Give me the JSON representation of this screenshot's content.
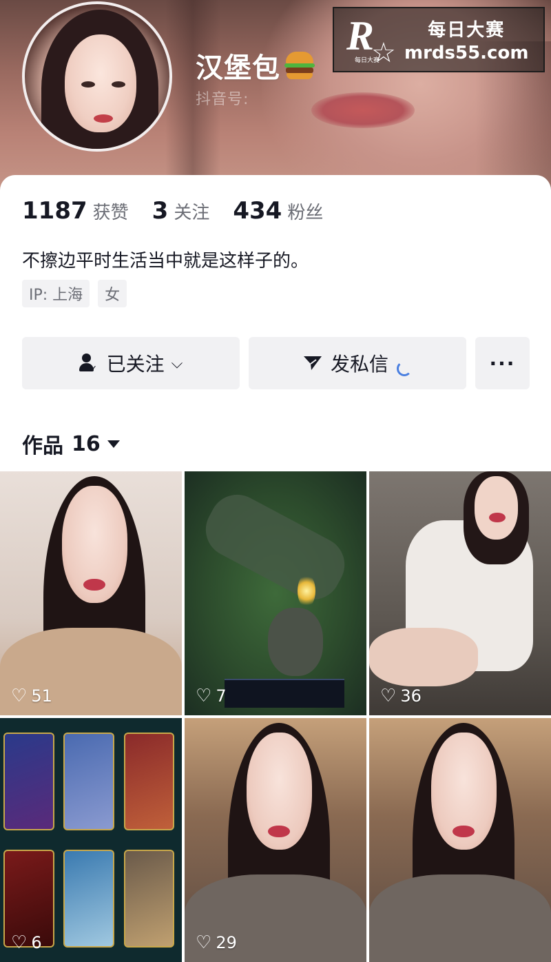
{
  "profile": {
    "nickname": "汉堡包",
    "nickname_emoji_icon": "hamburger-emoji",
    "douyin_id_label": "抖音号:",
    "stats": [
      {
        "value": "1187",
        "label": "获赞"
      },
      {
        "value": "3",
        "label": "关注"
      },
      {
        "value": "434",
        "label": "粉丝"
      }
    ],
    "bio": "不擦边平时生活当中就是这样子的。",
    "tags": [
      "IP: 上海",
      "女"
    ]
  },
  "actions": {
    "follow_label": "已关注",
    "follow_icon": "user-check-icon",
    "message_label": "发私信",
    "message_icon": "send-icon",
    "more_label": "···"
  },
  "works": {
    "tab_label": "作品",
    "count": "16"
  },
  "grid": [
    {
      "likes": "51",
      "kind": "selfie"
    },
    {
      "likes": "7",
      "kind": "game"
    },
    {
      "likes": "36",
      "kind": "bed"
    },
    {
      "likes": "6",
      "kind": "cards"
    },
    {
      "likes": "29",
      "kind": "selfie-grey"
    },
    {
      "likes": "",
      "kind": "selfie-grey"
    }
  ],
  "watermark": {
    "logo_letter": "R",
    "logo_caption": "每日大赛",
    "title": "每日大赛",
    "url": "mrds55.com"
  },
  "colors": {
    "text_primary": "#161823",
    "text_secondary": "#6b6d75",
    "button_bg": "#f1f1f3",
    "loading_accent": "#4a7fe0"
  }
}
